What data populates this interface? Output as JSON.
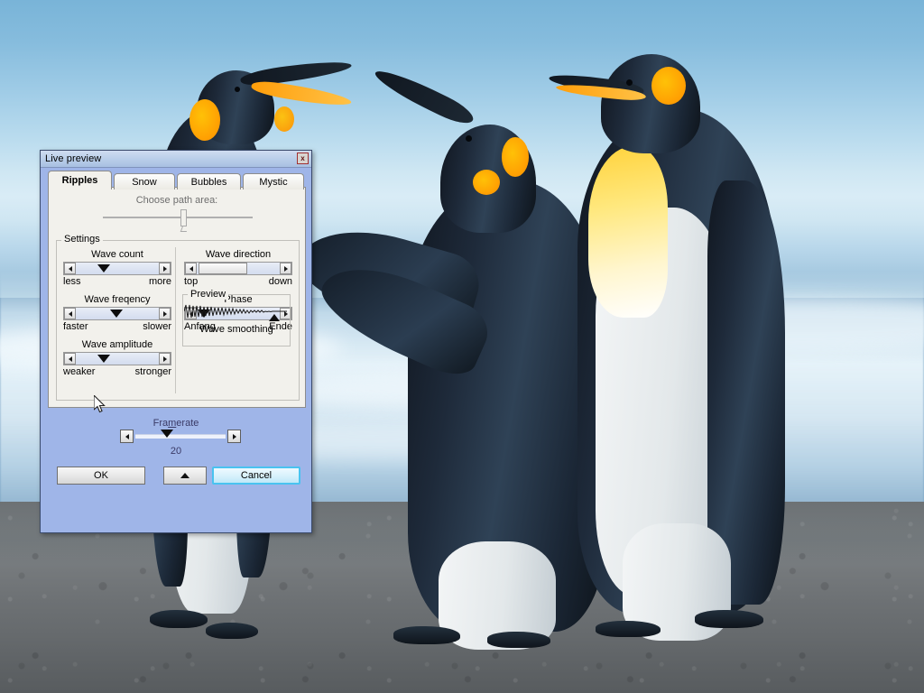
{
  "wallpaper": {
    "description": "three king penguins on a beach",
    "sky_color": "#9ecbe6",
    "sand_color": "#6d7174"
  },
  "dialog": {
    "title": "Live preview",
    "close_label": "x",
    "tabs": [
      {
        "label": "Ripples",
        "active": true
      },
      {
        "label": "Snow",
        "active": false
      },
      {
        "label": "Bubbles",
        "active": false
      },
      {
        "label": "Mystic",
        "active": false
      }
    ],
    "path_area": {
      "label": "Choose path area:",
      "value": 52,
      "enabled": false
    },
    "settings": {
      "legend": "Settings",
      "controls": [
        {
          "name": "wave-count",
          "title": "Wave count",
          "min_label": "less",
          "max_label": "more",
          "thumb_percent": 22,
          "style": "triangle"
        },
        {
          "name": "wave-direction",
          "title": "Wave direction",
          "min_label": "top",
          "max_label": "down",
          "thumb_percent": 6,
          "style": "box"
        },
        {
          "name": "wave-freqency",
          "title": "Wave freqency",
          "min_label": "faster",
          "max_label": "slower",
          "thumb_percent": 36,
          "style": "triangle"
        },
        {
          "name": "phase",
          "title": "Phase",
          "min_label": "Anfang",
          "max_label": "Ende",
          "thumb_percent": 3,
          "style": "triangle"
        },
        {
          "name": "wave-amplitude",
          "title": "Wave amplitude",
          "min_label": "weaker",
          "max_label": "stronger",
          "thumb_percent": 22,
          "style": "triangle"
        }
      ],
      "preview": {
        "legend": "Preview",
        "caption": "Wave smoothing"
      }
    },
    "framerate": {
      "label_before": "Fra",
      "label_accel": "m",
      "label_after": "erate",
      "value": "20",
      "thumb_percent": 24
    },
    "buttons": {
      "ok": "OK",
      "more": "",
      "cancel": "Cancel"
    }
  },
  "colors": {
    "dialog_body": "#9fb5e8",
    "panel": "#f2f1ec",
    "titlebar": "#bcd0ea",
    "focus_ring": "#49c3f0",
    "close_border": "#a03030"
  }
}
